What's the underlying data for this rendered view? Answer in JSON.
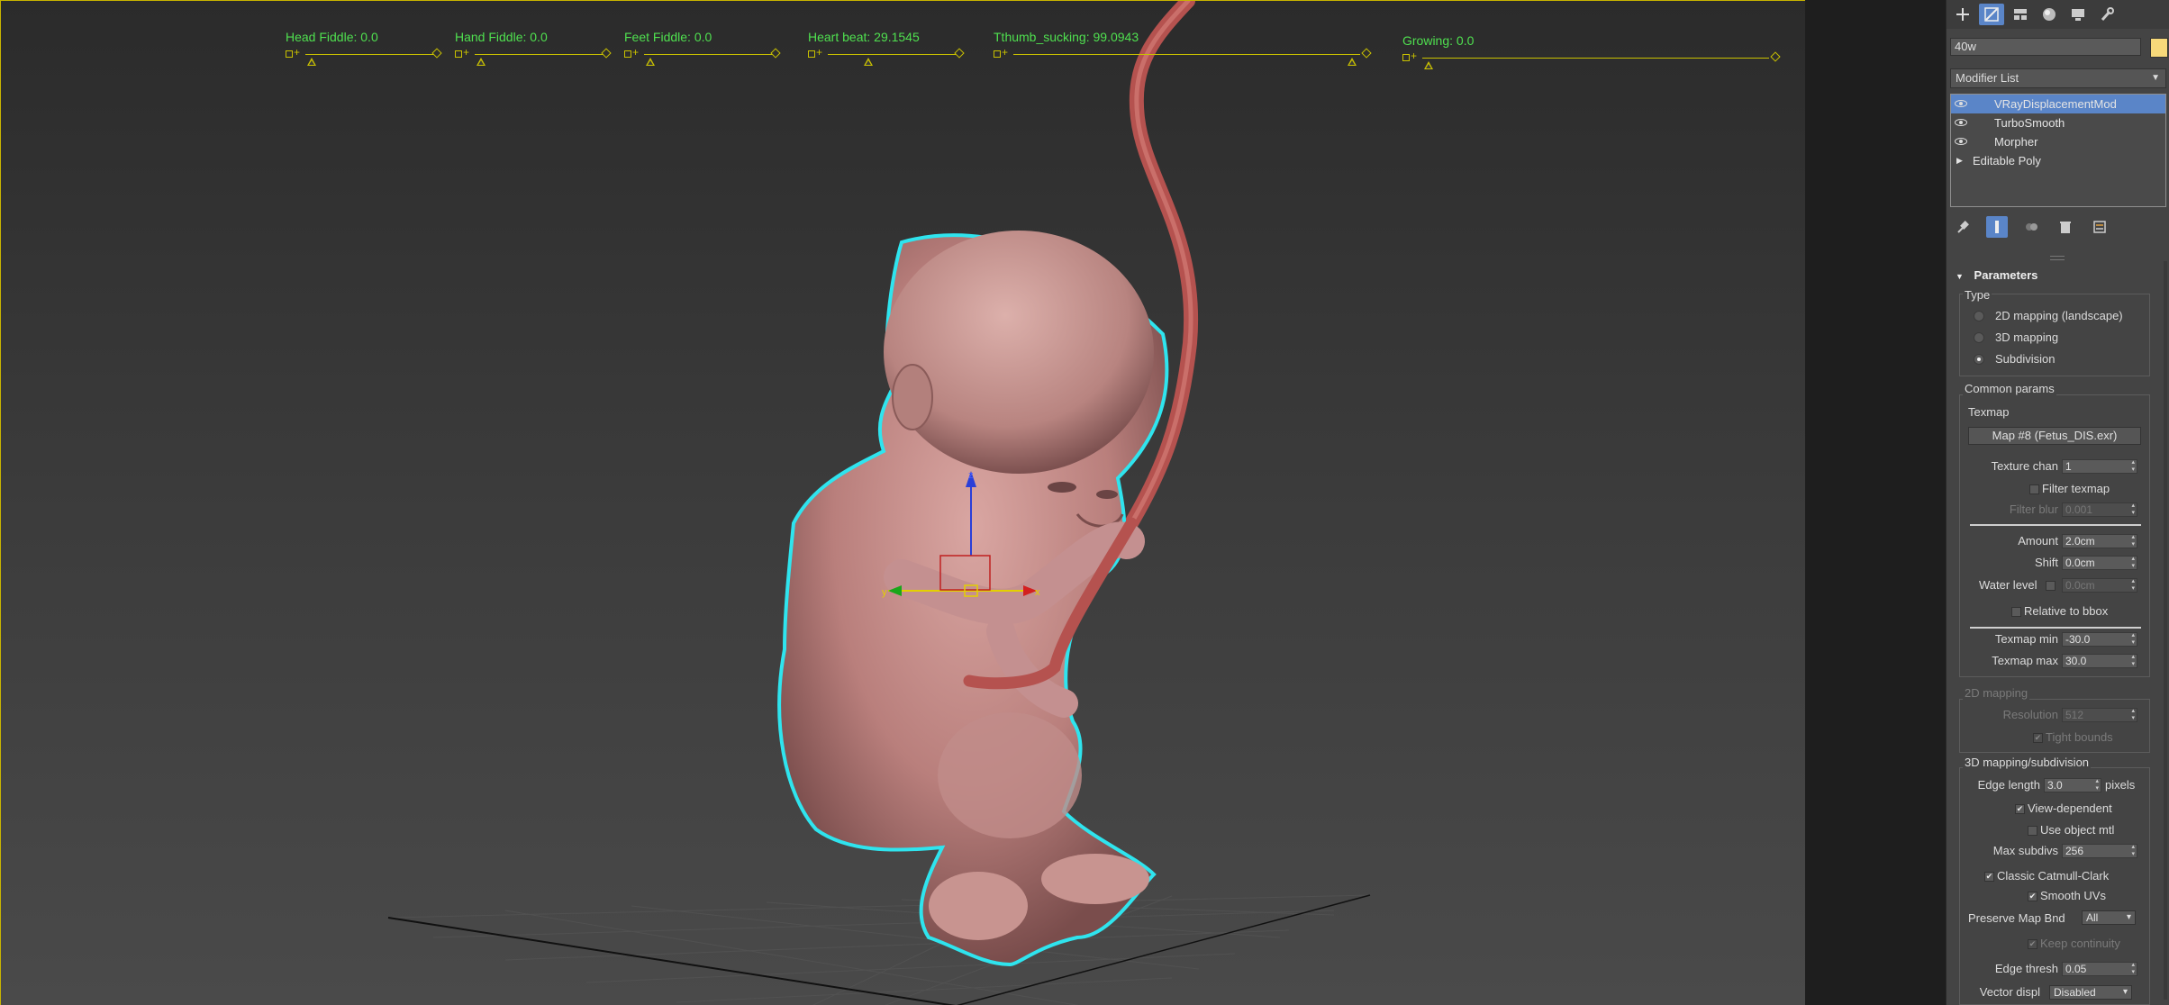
{
  "viewport": {
    "sliders": [
      {
        "label": "Head Fiddle: 0.0",
        "value": 0.0
      },
      {
        "label": "Hand Fiddle: 0.0",
        "value": 0.0
      },
      {
        "label": "Feet Fiddle: 0.0",
        "value": 0.0
      },
      {
        "label": "Heart beat: 29.1545",
        "value": 0.29
      },
      {
        "label": "Tthumb_sucking: 99.0943",
        "value": 0.99
      },
      {
        "label": "Growing: 0.0",
        "value": 0.0
      }
    ],
    "gizmo": {
      "z_label": "z",
      "x_label": "x",
      "y_label": "y"
    }
  },
  "panel": {
    "tabs": [
      "create-icon",
      "modify-icon",
      "hierarchy-icon",
      "motion-icon",
      "display-icon",
      "utilities-icon"
    ],
    "object_name": "40w",
    "object_color": "#f7d97a",
    "modifier_list_label": "Modifier List",
    "stack": [
      {
        "label": "VRayDisplacementMod",
        "selected": true
      },
      {
        "label": "TurboSmooth",
        "selected": false
      },
      {
        "label": "Morpher",
        "selected": false
      },
      {
        "label": "Editable Poly",
        "selected": false
      }
    ],
    "rollout_title": "Parameters",
    "type_group": {
      "title": "Type",
      "options": [
        "2D mapping (landscape)",
        "3D mapping",
        "Subdivision"
      ],
      "selected": "Subdivision"
    },
    "common": {
      "title": "Common params",
      "texmap_label": "Texmap",
      "texmap_button": "Map #8 (Fetus_DIS.exr)",
      "texture_chan_label": "Texture chan",
      "texture_chan": "1",
      "filter_texmap": "Filter texmap",
      "filter_blur_label": "Filter blur",
      "filter_blur": "0.001",
      "amount_label": "Amount",
      "amount": "2.0cm",
      "shift_label": "Shift",
      "shift": "0.0cm",
      "water_level_label": "Water level",
      "water_level": "0.0cm",
      "relative_bbox": "Relative to bbox",
      "texmap_min_label": "Texmap min",
      "texmap_min": "-30.0",
      "texmap_max_label": "Texmap max",
      "texmap_max": "30.0"
    },
    "mapping2d": {
      "title": "2D mapping",
      "resolution_label": "Resolution",
      "resolution": "512",
      "tight_bounds": "Tight bounds"
    },
    "mapping3d": {
      "title": "3D mapping/subdivision",
      "edge_length_label": "Edge length",
      "edge_length": "3.0",
      "pixels": "pixels",
      "view_dependent": "View-dependent",
      "use_object_mtl": "Use object mtl",
      "max_subdivs_label": "Max subdivs",
      "max_subdivs": "256",
      "classic_catmull": "Classic Catmull-Clark",
      "smooth_uvs": "Smooth UVs",
      "preserve_map_label": "Preserve Map Bnd",
      "preserve_map": "All",
      "keep_continuity": "Keep continuity",
      "edge_thresh_label": "Edge thresh",
      "edge_thresh": "0.05",
      "vector_displ_label": "Vector displ",
      "vector_displ": "Disabled"
    }
  }
}
